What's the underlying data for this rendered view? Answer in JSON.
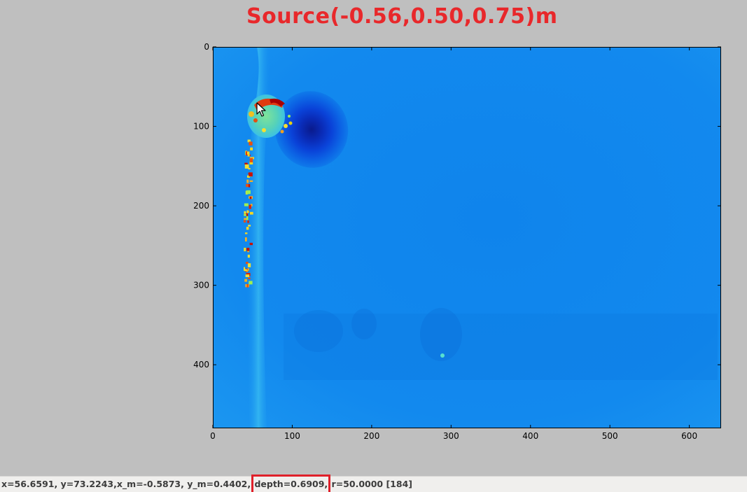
{
  "overlay": {
    "title": "Source(-0.56,0.50,0.75)m",
    "title_color": "#e8282b"
  },
  "plot": {
    "image_type": "depth-map-colormap-jet",
    "x_ticks": [
      "0",
      "100",
      "200",
      "300",
      "400",
      "500",
      "600"
    ],
    "y_ticks": [
      "0",
      "100",
      "200",
      "300",
      "400"
    ],
    "x_tick_values": [
      0,
      100,
      200,
      300,
      400,
      500,
      600
    ],
    "y_tick_values": [
      0,
      100,
      200,
      300,
      400
    ],
    "x_range": [
      0,
      640
    ],
    "y_range": [
      0,
      480
    ],
    "background_color": "#1188ee",
    "frame_color": "#000000"
  },
  "status": {
    "part1": "x=56.6591, y=73.2243,x_m=-0.5873, y_m=0.4402,",
    "depth": "depth=0.6909,",
    "part2": "r=50.0000 [184]",
    "highlight_color": "#e0202a"
  },
  "cursor": {
    "icon": "arrow-cursor-icon"
  },
  "window": {
    "background_color": "#bfbfbf"
  }
}
